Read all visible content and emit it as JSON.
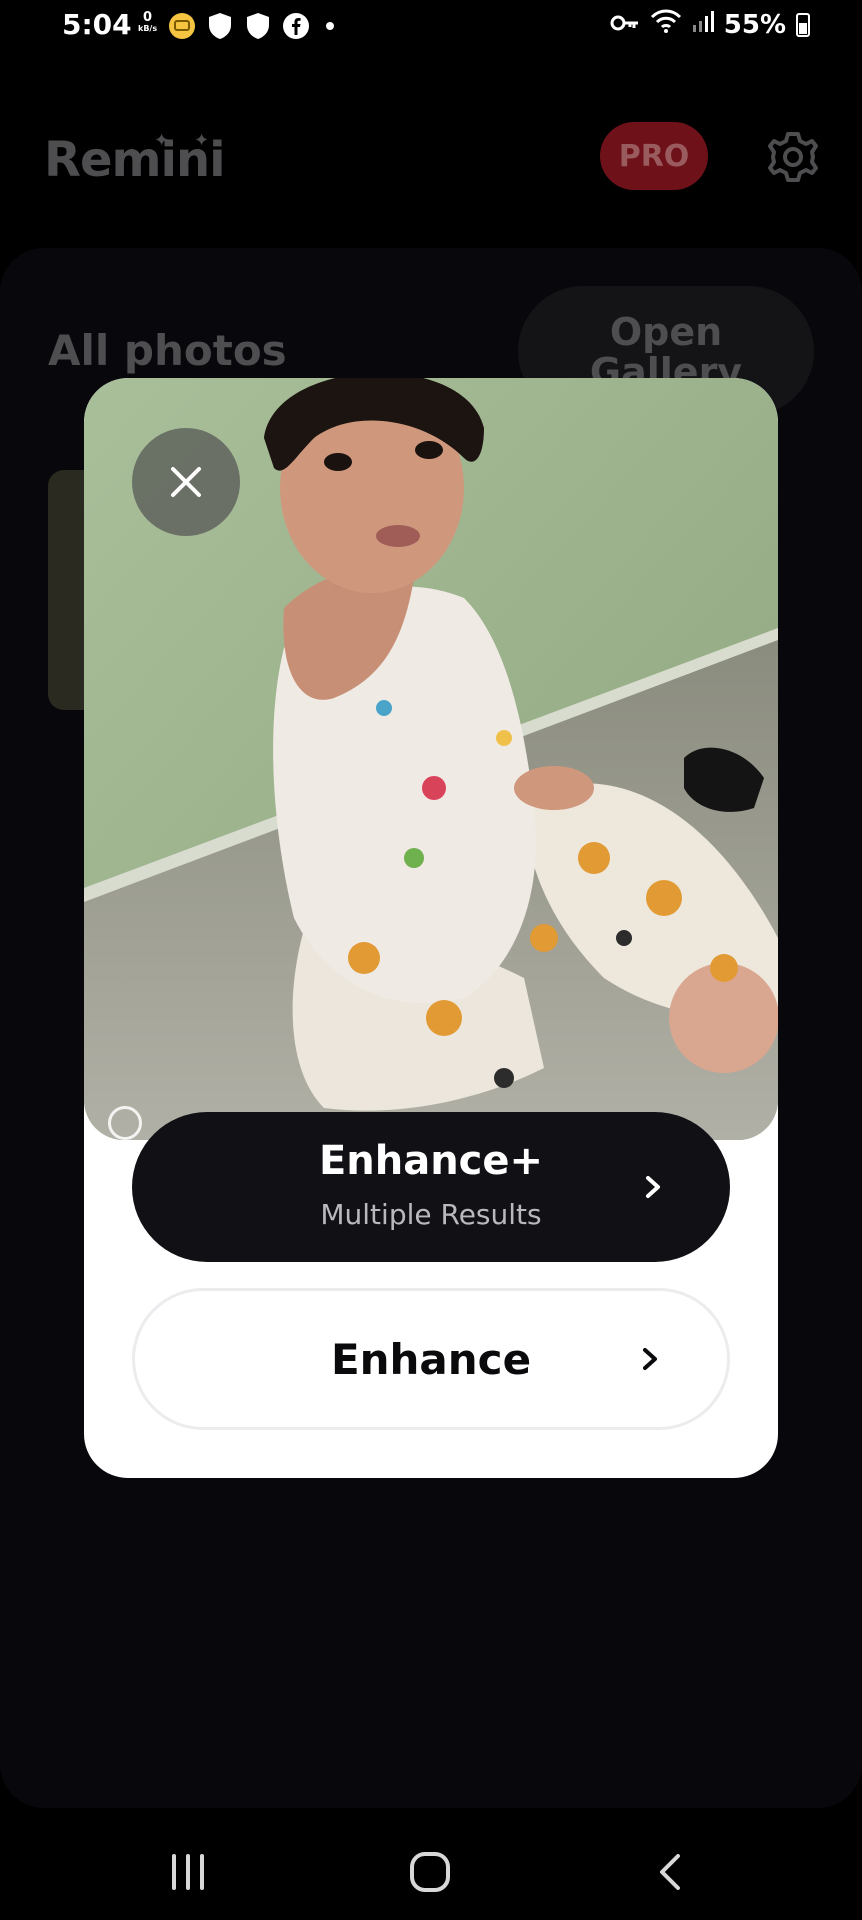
{
  "status_bar": {
    "time": "5:04",
    "net_speed_value": "0",
    "net_speed_unit": "kB/s",
    "battery": "55%",
    "icons": [
      "message-bubble-icon",
      "shield-icon",
      "shield-icon",
      "facebook-icon",
      "notification-dot-icon",
      "vpn-key-icon",
      "wifi-icon",
      "cell-signal-icon",
      "battery-icon"
    ]
  },
  "header": {
    "app_name": "Remini",
    "pro_label": "PRO"
  },
  "library": {
    "section_title": "All photos",
    "open_gallery_label": "Open Gallery"
  },
  "modal": {
    "enhance_plus": {
      "title": "Enhance+",
      "subtitle": "Multiple Results"
    },
    "enhance": {
      "title": "Enhance"
    }
  },
  "colors": {
    "background": "#000000",
    "pro_badge": "#6e1119",
    "primary_button": "#101015",
    "modal": "#ffffff"
  }
}
